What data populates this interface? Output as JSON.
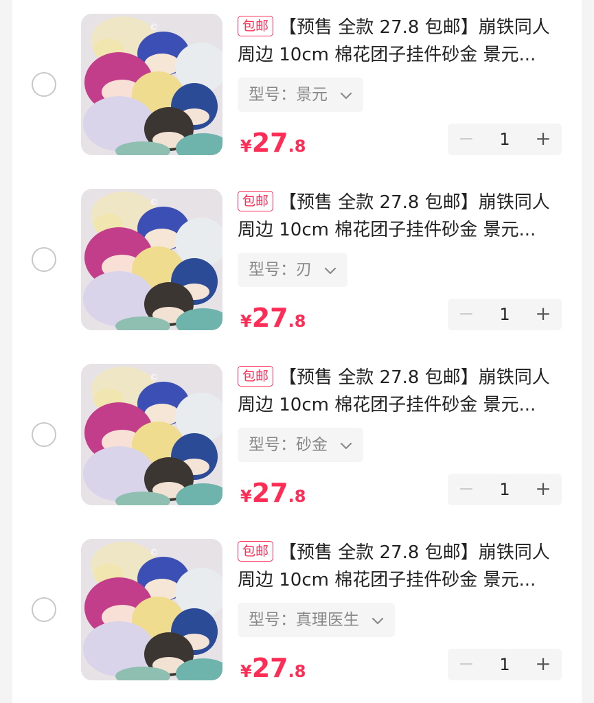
{
  "cart": {
    "items": [
      {
        "tag": "包邮",
        "title_line1": "【预售 全款 27.8 包邮】崩铁同人",
        "title_line2": "周边 10cm 棉花团子挂件砂金 景元...",
        "spec_label": "型号：",
        "spec_value": "景元",
        "currency": "¥",
        "price_int": "27",
        "price_dec": ".8",
        "quantity": "1",
        "minus": "−",
        "plus": "+"
      },
      {
        "tag": "包邮",
        "title_line1": "【预售 全款 27.8 包邮】崩铁同人",
        "title_line2": "周边 10cm 棉花团子挂件砂金 景元...",
        "spec_label": "型号：",
        "spec_value": "刃",
        "currency": "¥",
        "price_int": "27",
        "price_dec": ".8",
        "quantity": "1",
        "minus": "−",
        "plus": "+"
      },
      {
        "tag": "包邮",
        "title_line1": "【预售 全款 27.8 包邮】崩铁同人",
        "title_line2": "周边 10cm 棉花团子挂件砂金 景元...",
        "spec_label": "型号：",
        "spec_value": "砂金",
        "currency": "¥",
        "price_int": "27",
        "price_dec": ".8",
        "quantity": "1",
        "minus": "−",
        "plus": "+"
      },
      {
        "tag": "包邮",
        "title_line1": "【预售 全款 27.8 包邮】崩铁同人",
        "title_line2": "周边 10cm 棉花团子挂件砂金 景元...",
        "spec_label": "型号：",
        "spec_value": "真理医生",
        "currency": "¥",
        "price_int": "27",
        "price_dec": ".8",
        "quantity": "1",
        "minus": "−",
        "plus": "+"
      }
    ]
  },
  "colors": {
    "accent": "#ff2d55",
    "background": "#f4f4f4",
    "card": "#ffffff",
    "muted_text": "#888888"
  },
  "icons": {
    "radio": "radio-circle-icon",
    "spec_dropdown": "chevron-down-icon",
    "minus": "minus-icon",
    "plus": "plus-icon"
  }
}
